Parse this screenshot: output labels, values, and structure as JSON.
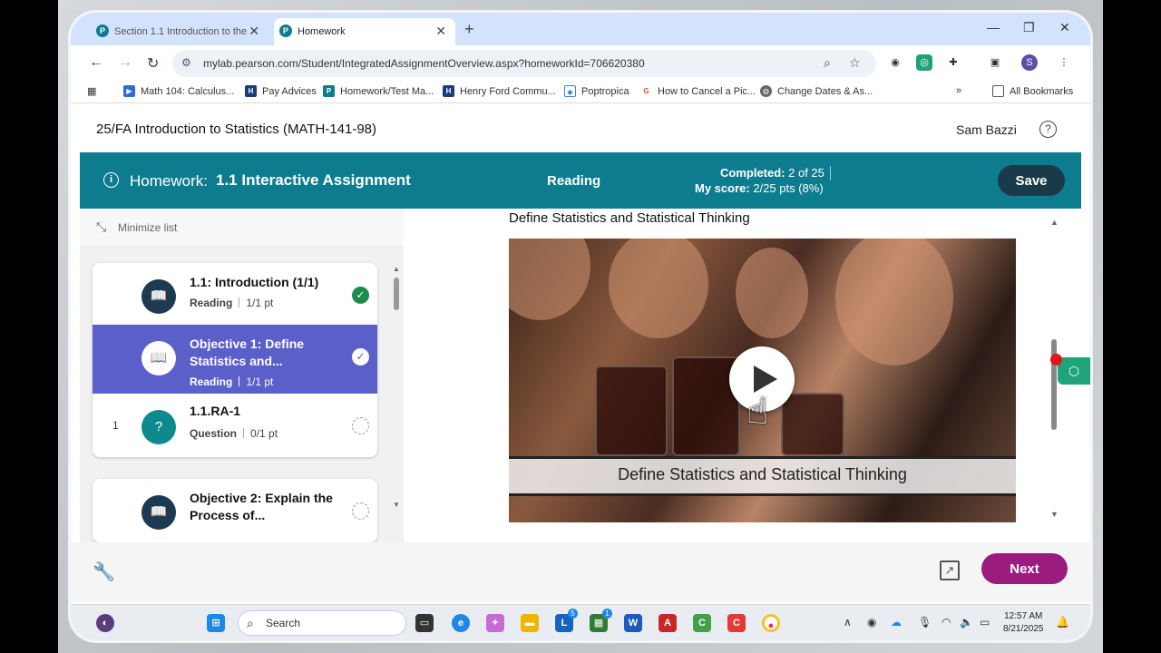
{
  "browser": {
    "tabs": [
      {
        "title": "Section 1.1 Introduction to the"
      },
      {
        "title": "Homework"
      }
    ],
    "url": "mylab.pearson.com/Student/IntegratedAssignmentOverview.aspx?homeworkId=706620380",
    "bookmarks": [
      {
        "label": "Math 104: Calculus..."
      },
      {
        "label": "Pay Advices"
      },
      {
        "label": "Homework/Test Ma..."
      },
      {
        "label": "Henry Ford Commu..."
      },
      {
        "label": "Poptropica"
      },
      {
        "label": "How to Cancel a Pic..."
      },
      {
        "label": "Change Dates & As..."
      }
    ],
    "all_bookmarks": "All Bookmarks"
  },
  "page": {
    "course_title": "25/FA Introduction to Statistics (MATH-141-98)",
    "user_name": "Sam Bazzi"
  },
  "banner": {
    "homework_label": "Homework:",
    "homework_name": "1.1 Interactive Assignment",
    "mode": "Reading",
    "completed_label": "Completed:",
    "completed_value": "2 of 25",
    "score_label": "My score:",
    "score_value": "2/25 pts (8%)",
    "save_label": "Save"
  },
  "list": {
    "minimize_label": "Minimize list",
    "items": [
      {
        "number": "",
        "title": "1.1: Introduction (1/1)",
        "type": "Reading",
        "points": "1/1 pt",
        "status": "complete"
      },
      {
        "number": "",
        "title": "Objective 1: Define Statistics and...",
        "type": "Reading",
        "points": "1/1 pt",
        "status": "complete",
        "selected": true
      },
      {
        "number": "1",
        "title": "1.1.RA-1",
        "type": "Question",
        "points": "0/1 pt",
        "status": "incomplete"
      },
      {
        "number": "",
        "title": "Objective 2: Explain the Process of...",
        "type": "",
        "points": "",
        "status": "incomplete"
      }
    ]
  },
  "content": {
    "heading": "Define Statistics and Statistical Thinking",
    "video_caption": "Define Statistics and Statistical Thinking"
  },
  "footer": {
    "next_label": "Next"
  },
  "taskbar": {
    "search_label": "Search",
    "time": "12:57 AM",
    "date": "8/21/2025",
    "badge_l": "5",
    "badge_store": "1"
  }
}
